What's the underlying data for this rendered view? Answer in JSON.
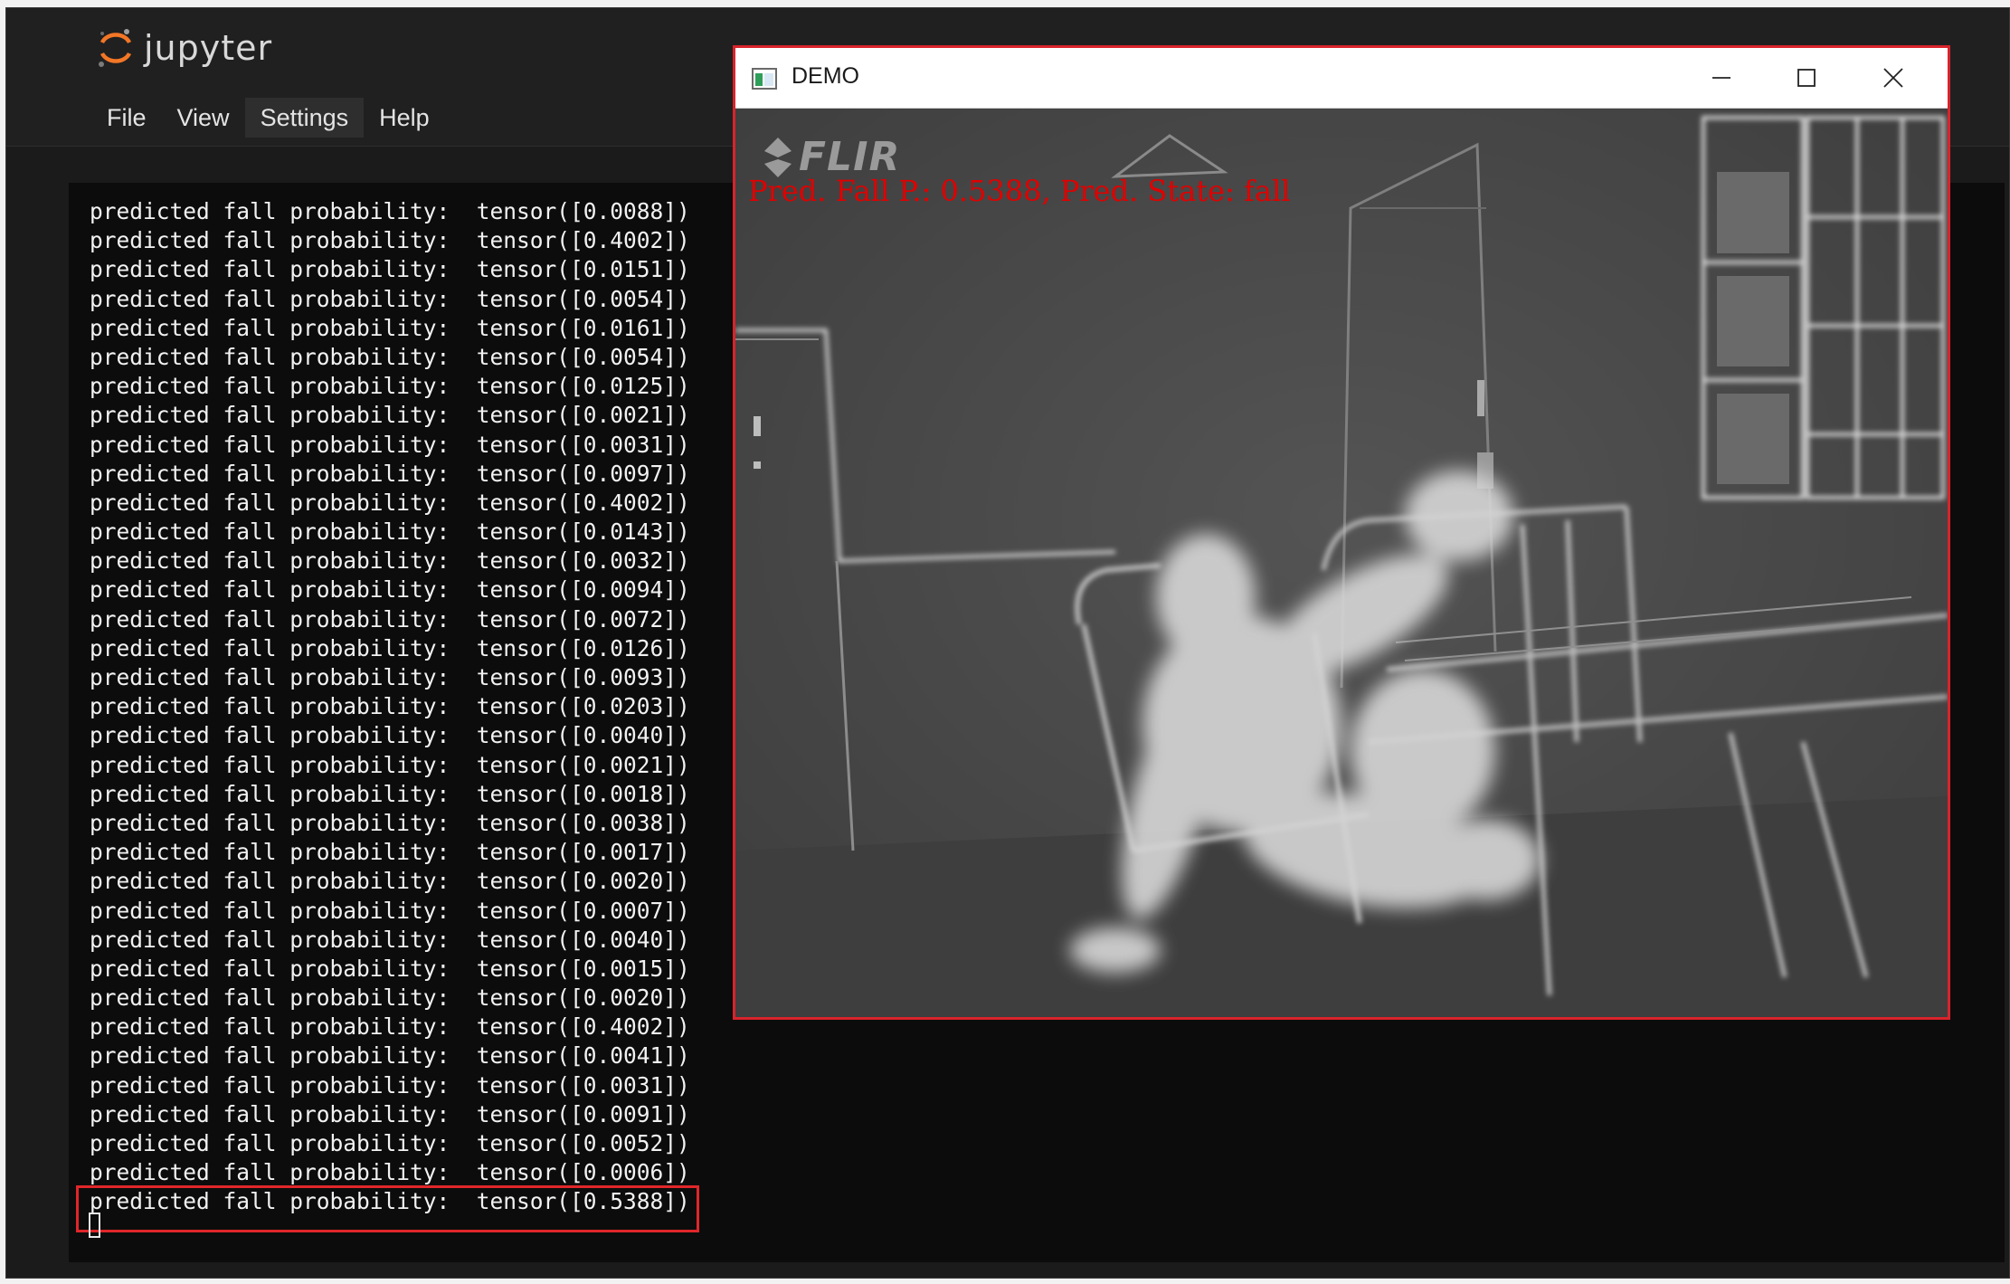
{
  "app": {
    "logo_text": "jupyter"
  },
  "menu": {
    "items": [
      {
        "label": "File"
      },
      {
        "label": "View"
      },
      {
        "label": "Settings",
        "active": true
      },
      {
        "label": "Help"
      }
    ]
  },
  "terminal": {
    "prefix": "predicted fall probability:  ",
    "lines": [
      "tensor([0.0088])",
      "tensor([0.4002])",
      "tensor([0.0151])",
      "tensor([0.0054])",
      "tensor([0.0161])",
      "tensor([0.0054])",
      "tensor([0.0125])",
      "tensor([0.0021])",
      "tensor([0.0031])",
      "tensor([0.0097])",
      "tensor([0.4002])",
      "tensor([0.0143])",
      "tensor([0.0032])",
      "tensor([0.0094])",
      "tensor([0.0072])",
      "tensor([0.0126])",
      "tensor([0.0093])",
      "tensor([0.0203])",
      "tensor([0.0040])",
      "tensor([0.0021])",
      "tensor([0.0018])",
      "tensor([0.0038])",
      "tensor([0.0017])",
      "tensor([0.0020])",
      "tensor([0.0007])",
      "tensor([0.0040])",
      "tensor([0.0015])",
      "tensor([0.0020])",
      "tensor([0.4002])",
      "tensor([0.0041])",
      "tensor([0.0031])",
      "tensor([0.0091])",
      "tensor([0.0052])",
      "tensor([0.0006])",
      "tensor([0.5388])"
    ]
  },
  "demo_window": {
    "title": "DEMO",
    "logo_text": "FLIR",
    "overlay_text": "Pred. Fall P.: 0.5388, Pred. State: fall",
    "controls": {
      "minimize_icon": "minimize-icon",
      "maximize_icon": "maximize-icon",
      "close_icon": "close-icon"
    }
  },
  "colors": {
    "highlight": "#e0262a",
    "overlay_text": "#e00000",
    "terminal_bg": "#0c0c0c",
    "app_bg": "#1b1b1b"
  }
}
